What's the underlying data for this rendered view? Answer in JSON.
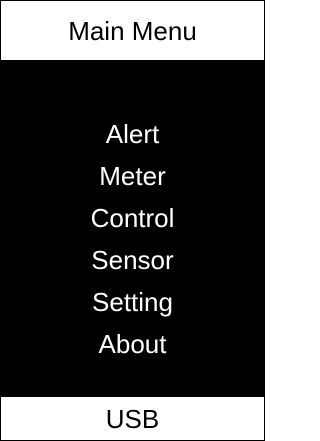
{
  "header": {
    "title": "Main Menu"
  },
  "menu": {
    "items": [
      {
        "label": "Alert"
      },
      {
        "label": "Meter"
      },
      {
        "label": "Control"
      },
      {
        "label": "Sensor"
      },
      {
        "label": "Setting"
      },
      {
        "label": "About"
      }
    ]
  },
  "footer": {
    "label": "USB"
  },
  "colors": {
    "menu_background": "#000000",
    "menu_text": "#ffffff",
    "header_background": "#ffffff",
    "header_text": "#000000"
  }
}
